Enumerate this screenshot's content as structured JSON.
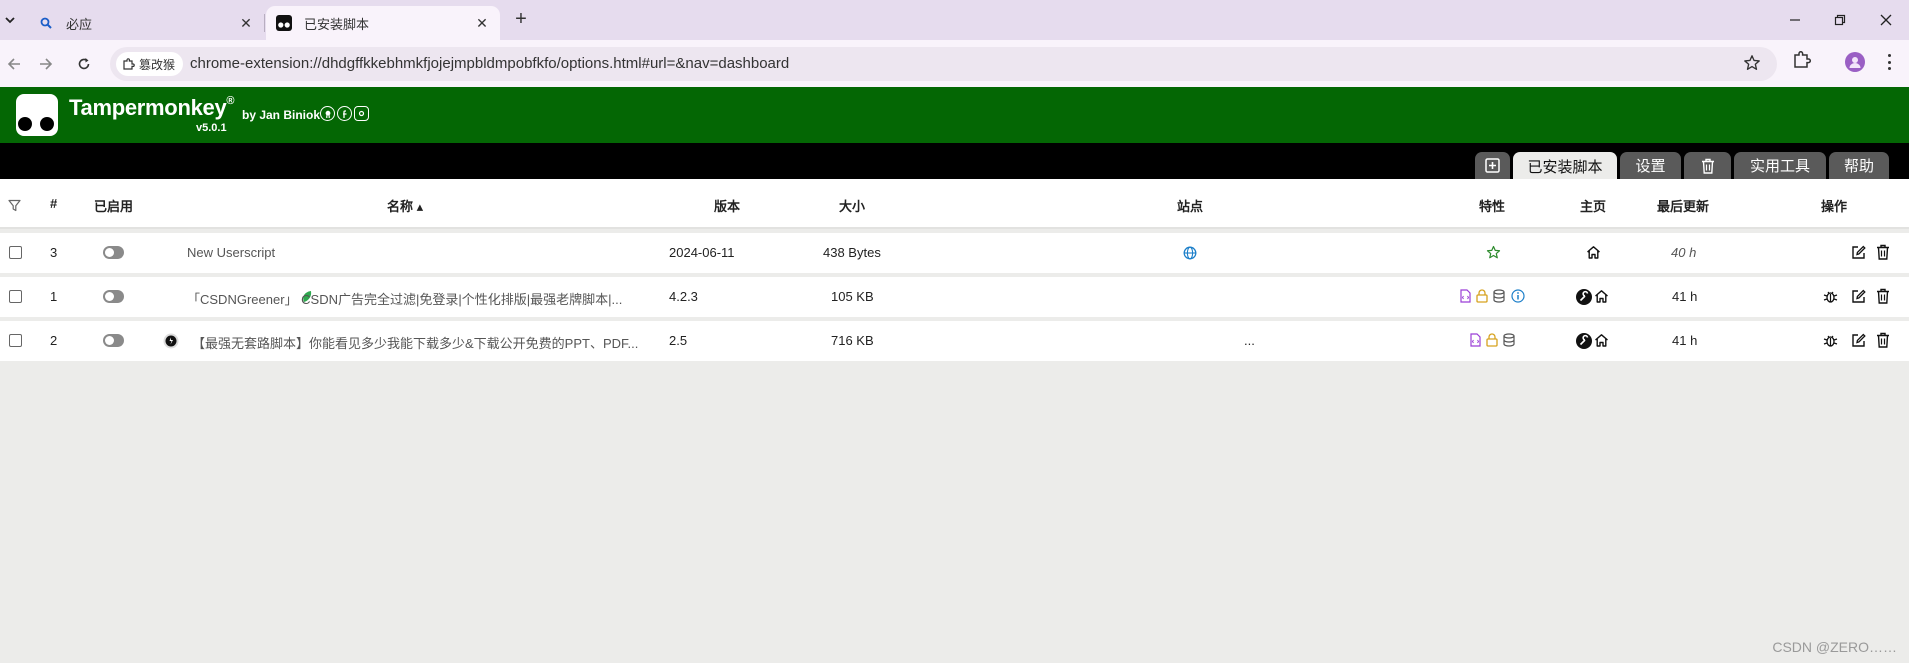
{
  "browser": {
    "tabs": [
      {
        "title": "必应",
        "icon": "search-icon",
        "active": false
      },
      {
        "title": "已安装脚本",
        "icon": "tampermonkey-icon",
        "active": true
      }
    ],
    "site_chip": "篡改猴",
    "url": "chrome-extension://dhdgffkkebhmkfjojejmpbldmpobfkfo/options.html#url=&nav=dashboard"
  },
  "tm": {
    "title": "Tampermonkey",
    "registered": "®",
    "by": "by Jan Biniok",
    "version": "v5.0.1",
    "tabs": [
      "已安装脚本",
      "设置",
      "实用工具",
      "帮助"
    ],
    "accent": "#046704"
  },
  "table": {
    "headers": {
      "num": "#",
      "enabled": "已启用",
      "name": "名称 ▴",
      "version": "版本",
      "size": "大小",
      "sites": "站点",
      "features": "特性",
      "homepage": "主页",
      "updated": "最后更新",
      "actions": "操作"
    },
    "rows": [
      {
        "num": "3",
        "name": "New Userscript",
        "version": "2024-06-11",
        "size": "438 Bytes",
        "sites": "",
        "updated": "40 h"
      },
      {
        "num": "1",
        "name": "「CSDNGreener」 CSDN广告完全过滤|免登录|个性化排版|最强老牌脚本|...",
        "version": "4.2.3",
        "size": "105 KB",
        "sites": "",
        "updated": "41 h"
      },
      {
        "num": "2",
        "name": "【最强无套路脚本】你能看见多少我能下载多少&下载公开免费的PPT、PDF...",
        "version": "2.5",
        "size": "716 KB",
        "sites": "...",
        "updated": "41 h"
      }
    ]
  },
  "watermark": "CSDN @ZERO……"
}
